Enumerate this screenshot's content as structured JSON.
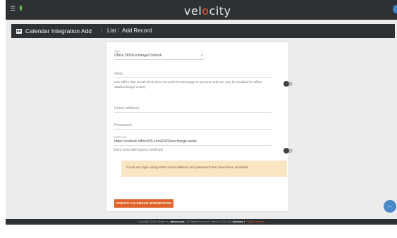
{
  "app": {
    "logo_text": "velocity"
  },
  "header": {
    "title": "Calendar Integration Add",
    "separator": "/",
    "breadcrumb_list": "List",
    "breadcrumb_current": "Add Record"
  },
  "form": {
    "type_label": "Type",
    "type_value": "Office 365/Exchange/Outlook",
    "alias_placeholder": "Alias",
    "oauth_note": "Use Office 365 OAuth (This does not work for Exchange on premise and can only be enabled for Office 365/Exchange online)",
    "email_placeholder": "Email address",
    "password_placeholder": "Password",
    "ews_url_label": "EWS URL",
    "ews_url_value": "https://outlook.office365.com/EWS/exchange.asmx",
    "ews_selfsigned_label": "EWS Allow Self Signed Certificate",
    "alert_text": "Could not login using EWS email address and password that have been provided",
    "submit_label": "CREATE CALENDAR INTEGRATION"
  },
  "footer": {
    "copyright": "Copyright ©2020 Mobile Inc (",
    "link": "atlona.com",
    "rights": "). All Rights Reserved  |  Version 2.9.1.628  |",
    "gateway": "Gateway 1",
    "sep": " · ",
    "status": "Active Gateway"
  },
  "colors": {
    "accent": "#e0632a",
    "bar": "#2d3133",
    "fab": "#4a88c7",
    "alert_bg": "#fbe6c3"
  },
  "icons": [
    "menu-icon",
    "leaf-icon",
    "calendar-icon",
    "back-arrow-icon"
  ]
}
